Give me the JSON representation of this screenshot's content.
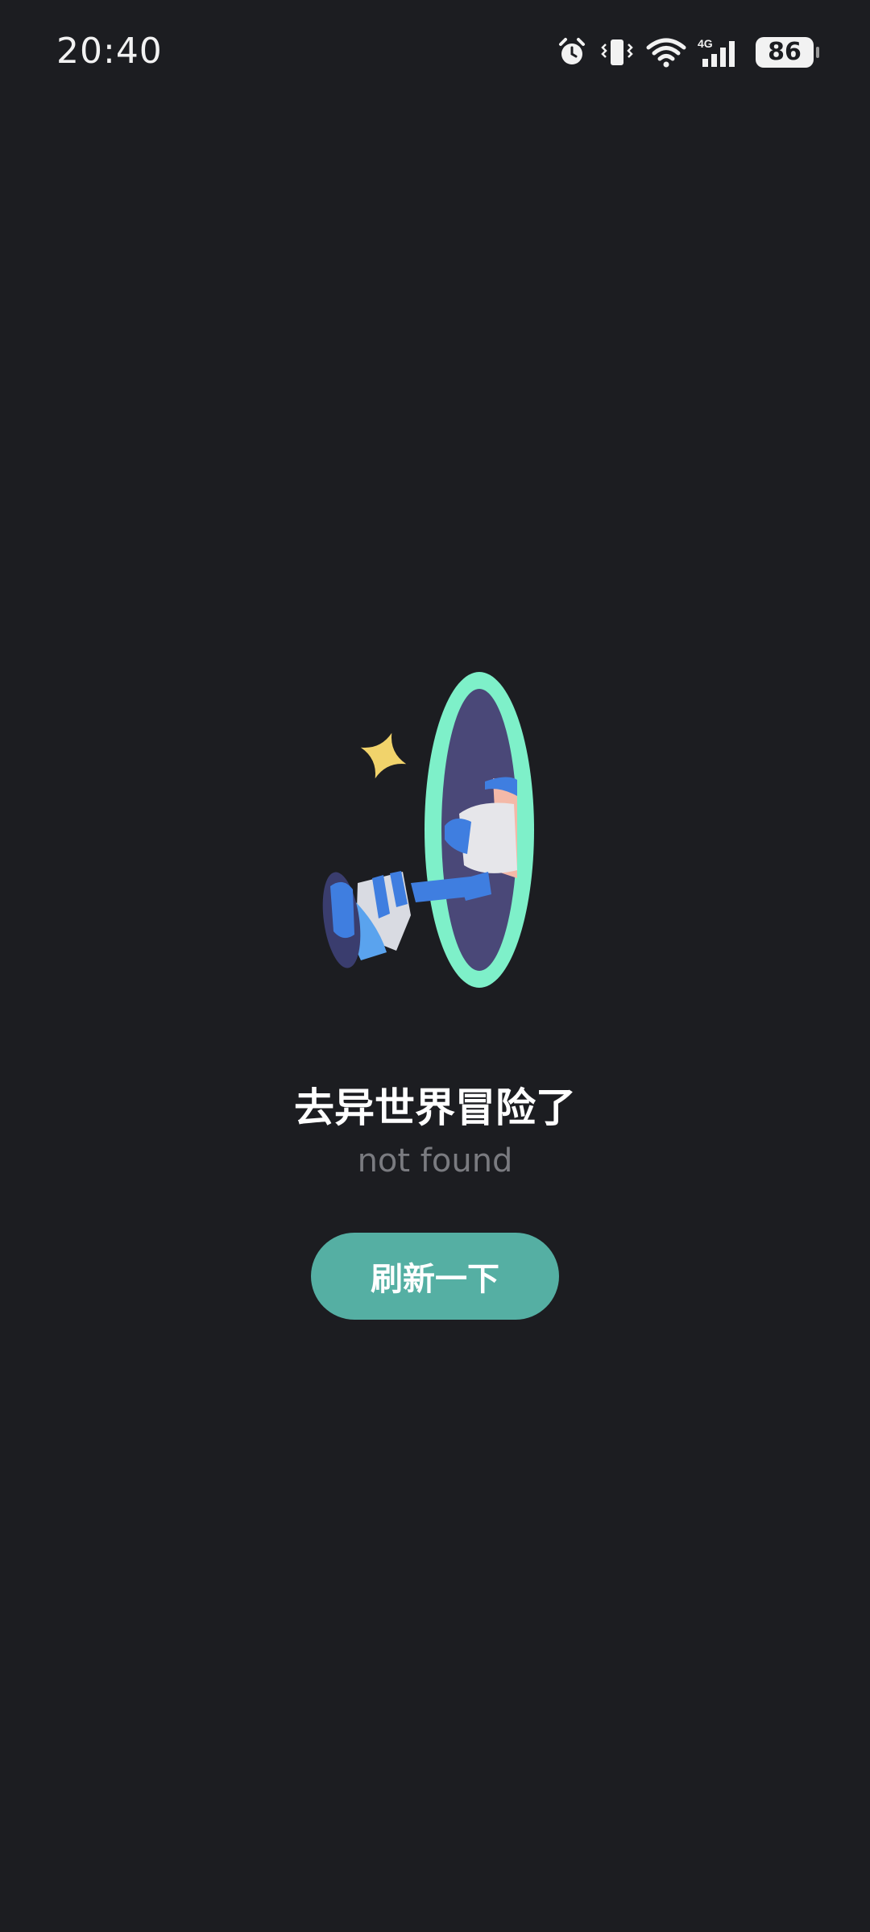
{
  "status_bar": {
    "time": "20:40",
    "network": "4G",
    "battery_level": "86",
    "icons": [
      "alarm-icon",
      "vibrate-icon",
      "wifi-icon",
      "cellular-signal-icon",
      "battery-icon"
    ]
  },
  "empty_state": {
    "illustration": "portal-leg-illustration",
    "title": "去异世界冒险了",
    "subtitle": "not found"
  },
  "actions": {
    "refresh_label": "刷新一下"
  },
  "colors": {
    "background": "#1c1d21",
    "accent": "#55afa3",
    "portal_ring": "#7ef0c9",
    "sparkle": "#f1d36b"
  }
}
